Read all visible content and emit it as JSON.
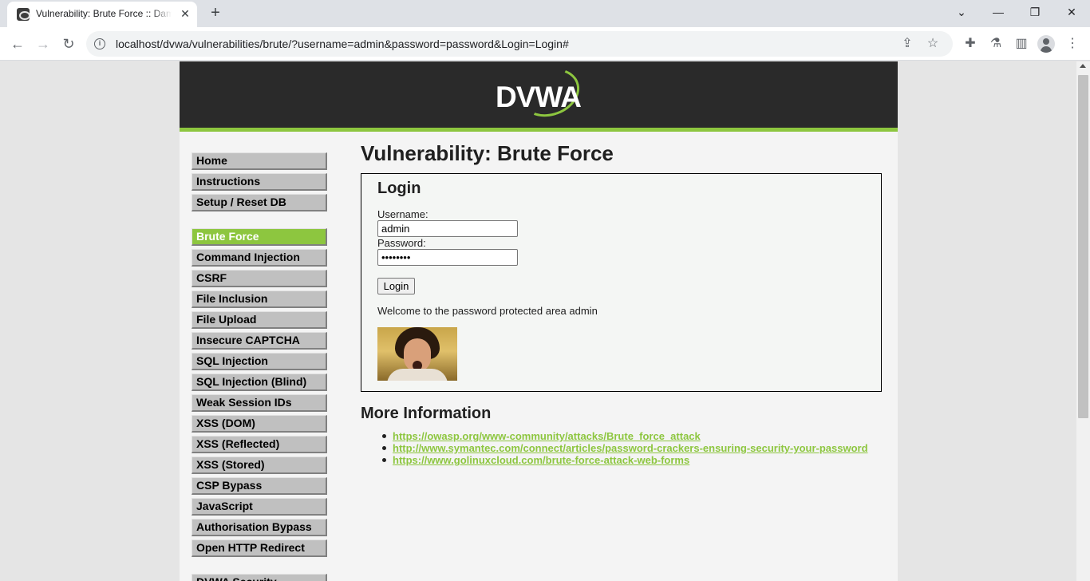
{
  "browser": {
    "tab_title": "Vulnerability: Brute Force :: Damn Vulnerable Web Application (DVWA)",
    "url": "localhost/dvwa/vulnerabilities/brute/?username=admin&password=password&Login=Login#"
  },
  "header": {
    "logo_text": "DVWA"
  },
  "menu": {
    "items": [
      {
        "label": "Home"
      },
      {
        "label": "Instructions"
      },
      {
        "label": "Setup / Reset DB"
      },
      {
        "label": "Brute Force"
      },
      {
        "label": "Command Injection"
      },
      {
        "label": "CSRF"
      },
      {
        "label": "File Inclusion"
      },
      {
        "label": "File Upload"
      },
      {
        "label": "Insecure CAPTCHA"
      },
      {
        "label": "SQL Injection"
      },
      {
        "label": "SQL Injection (Blind)"
      },
      {
        "label": "Weak Session IDs"
      },
      {
        "label": "XSS (DOM)"
      },
      {
        "label": "XSS (Reflected)"
      },
      {
        "label": "XSS (Stored)"
      },
      {
        "label": "CSP Bypass"
      },
      {
        "label": "JavaScript"
      },
      {
        "label": "Authorisation Bypass"
      },
      {
        "label": "Open HTTP Redirect"
      },
      {
        "label": "DVWA Security"
      }
    ],
    "active": "Brute Force"
  },
  "main": {
    "title": "Vulnerability: Brute Force",
    "login_heading": "Login",
    "username_label": "Username:",
    "username_value": "admin",
    "password_label": "Password:",
    "password_value": "password",
    "login_button": "Login",
    "welcome_text": "Welcome to the password protected area admin",
    "more_info_heading": "More Information",
    "links": [
      {
        "text": "https://owasp.org/www-community/attacks/Brute_force_attack"
      },
      {
        "text": "http://www.symantec.com/connect/articles/password-crackers-ensuring-security-your-password"
      },
      {
        "text": "https://www.golinuxcloud.com/brute-force-attack-web-forms"
      }
    ]
  },
  "colors": {
    "accent": "#8dc63f",
    "header_bg": "#2a2a2a"
  }
}
